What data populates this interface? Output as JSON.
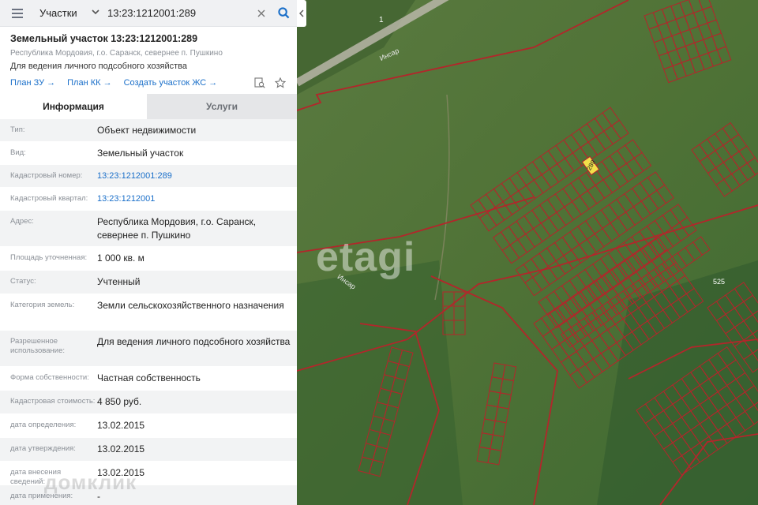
{
  "search": {
    "type_label": "Участки",
    "query": "13:23:1212001:289"
  },
  "parcel": {
    "title": "Земельный участок 13:23:1212001:289",
    "address_line": "Республика Мордовия, г.о. Саранск, севернее п. Пушкино",
    "use": "Для ведения личного подсобного хозяйства",
    "links": [
      "План ЗУ →",
      "План КК →",
      "Создать участок ЖС →"
    ]
  },
  "tabs": [
    "Информация",
    "Услуги"
  ],
  "info_rows": [
    {
      "label": "Тип:",
      "value": "Объект недвижимости"
    },
    {
      "label": "Вид:",
      "value": "Земельный участок"
    },
    {
      "label": "Кадастровый номер:",
      "value": "13:23:1212001:289"
    },
    {
      "label": "Кадастровый квартал:",
      "value": "13:23:1212001"
    },
    {
      "label": "Адрес:",
      "value": "Республика Мордовия, г.о. Саранск, севернее п. Пушкино"
    },
    {
      "label": "Площадь уточненная:",
      "value": "1 000 кв. м"
    },
    {
      "label": "Статус:",
      "value": "Учтенный"
    },
    {
      "label": "Категория земель:",
      "value": "Земли сельскохозяйственного назначения"
    },
    {
      "label": "Разрешенное использование:",
      "value": "Для ведения личного подсобного хозяйства"
    },
    {
      "label": "Форма собственности:",
      "value": "Частная собственность"
    },
    {
      "label": "Кадастровая стоимость:",
      "value": "4 850 руб."
    },
    {
      "label": "дата определения:",
      "value": "13.02.2015"
    },
    {
      "label": "дата утверждения:",
      "value": "13.02.2015"
    },
    {
      "label": "дата внесения сведений:",
      "value": "13.02.2015"
    },
    {
      "label": "дата применения:",
      "value": "-"
    }
  ],
  "map": {
    "watermark": "etagi",
    "brand_watermark": "домклик",
    "selected_parcel": "289",
    "labels": {
      "river_1": "Инсар",
      "river_2": "Инсар",
      "road_num": "1",
      "area_525": "525"
    },
    "colors": {
      "parcel_border": "#b3262b",
      "selected_fill": "#f2e04a",
      "accent_link": "#1a6fc9"
    }
  }
}
